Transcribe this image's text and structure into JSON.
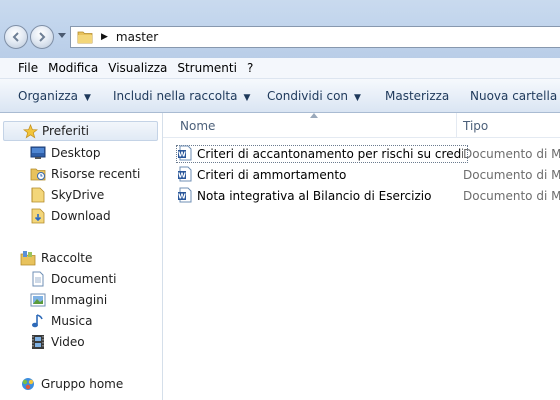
{
  "address": {
    "path": "master"
  },
  "menu": [
    "File",
    "Modifica",
    "Visualizza",
    "Strumenti",
    "?"
  ],
  "commands": {
    "organize": "Organizza",
    "include": "Includi nella raccolta",
    "share": "Condividi con",
    "burn": "Masterizza",
    "new_folder": "Nuova cartella"
  },
  "nav": {
    "favorites": "Preferiti",
    "desktop": "Desktop",
    "recent": "Risorse recenti",
    "skydrive": "SkyDrive",
    "download": "Download",
    "libraries": "Raccolte",
    "documents": "Documenti",
    "pictures": "Immagini",
    "music": "Musica",
    "video": "Video",
    "homegroup": "Gruppo home"
  },
  "columns": {
    "name": "Nome",
    "type": "Tipo"
  },
  "files": [
    {
      "name": "Criteri di accantonamento per rischi su crediti",
      "type": "Documento di Mic"
    },
    {
      "name": "Criteri di ammortamento",
      "type": "Documento di Mic"
    },
    {
      "name": "Nota integrativa al Bilancio di Esercizio",
      "type": "Documento di Mic"
    }
  ],
  "colors": {
    "accent": "#1e395b",
    "word_blue": "#2a5699"
  },
  "icons": {
    "back": "back-arrow-icon",
    "forward": "forward-arrow-icon",
    "folder": "folder-icon",
    "word": "word-document-icon",
    "star": "star-icon"
  }
}
